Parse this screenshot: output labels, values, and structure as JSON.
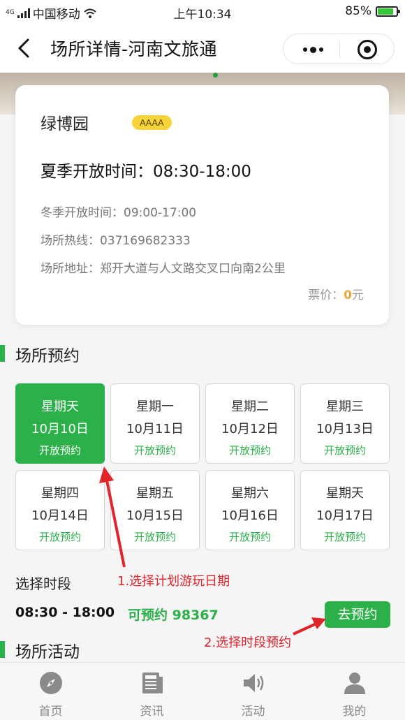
{
  "status_bar": {
    "carrier": "中国移动",
    "network": "4G",
    "time": "上午10:34",
    "battery": "85%",
    "battery_level": 0.85
  },
  "nav": {
    "title": "场所详情-河南文旅通"
  },
  "venue": {
    "name": "绿博园",
    "level": "AAAA",
    "summer_hours": "夏季开放时间：08:30-18:00",
    "winter_hours": "冬季开放时间：09:00-17:00",
    "hotline": "场所热线：037169682333",
    "address": "场所地址：郑开大道与人文路交叉口向南2公里",
    "price_label": "票价：",
    "price_value": "0",
    "price_unit": "元"
  },
  "reservation": {
    "section_title": "场所预约",
    "days": [
      {
        "weekday": "星期天",
        "date": "10月10日",
        "status": "开放预约",
        "selected": true
      },
      {
        "weekday": "星期一",
        "date": "10月11日",
        "status": "开放预约",
        "selected": false
      },
      {
        "weekday": "星期二",
        "date": "10月12日",
        "status": "开放预约",
        "selected": false
      },
      {
        "weekday": "星期三",
        "date": "10月13日",
        "status": "开放预约",
        "selected": false
      },
      {
        "weekday": "星期四",
        "date": "10月14日",
        "status": "开放预约",
        "selected": false
      },
      {
        "weekday": "星期五",
        "date": "10月15日",
        "status": "开放预约",
        "selected": false
      },
      {
        "weekday": "星期六",
        "date": "10月16日",
        "status": "开放预约",
        "selected": false
      },
      {
        "weekday": "星期天",
        "date": "10月17日",
        "status": "开放预约",
        "selected": false
      }
    ],
    "time_section_label": "选择时段",
    "slot": {
      "range": "08:30 - 18:00",
      "availability": "可预约 98367",
      "book_label": "去预约"
    }
  },
  "annotations": {
    "step1": "1.选择计划游玩日期",
    "step2": "2.选择时段预约",
    "color": "#e0242b"
  },
  "activities": {
    "section_title": "场所活动"
  },
  "tabbar": {
    "items": [
      {
        "label": "首页",
        "icon": "compass-icon"
      },
      {
        "label": "资讯",
        "icon": "news-icon"
      },
      {
        "label": "活动",
        "icon": "speaker-icon"
      },
      {
        "label": "我的",
        "icon": "user-icon"
      }
    ]
  },
  "colors": {
    "accent": "#2bb04a",
    "badge": "#f7d33a",
    "price": "#e8a83b"
  }
}
